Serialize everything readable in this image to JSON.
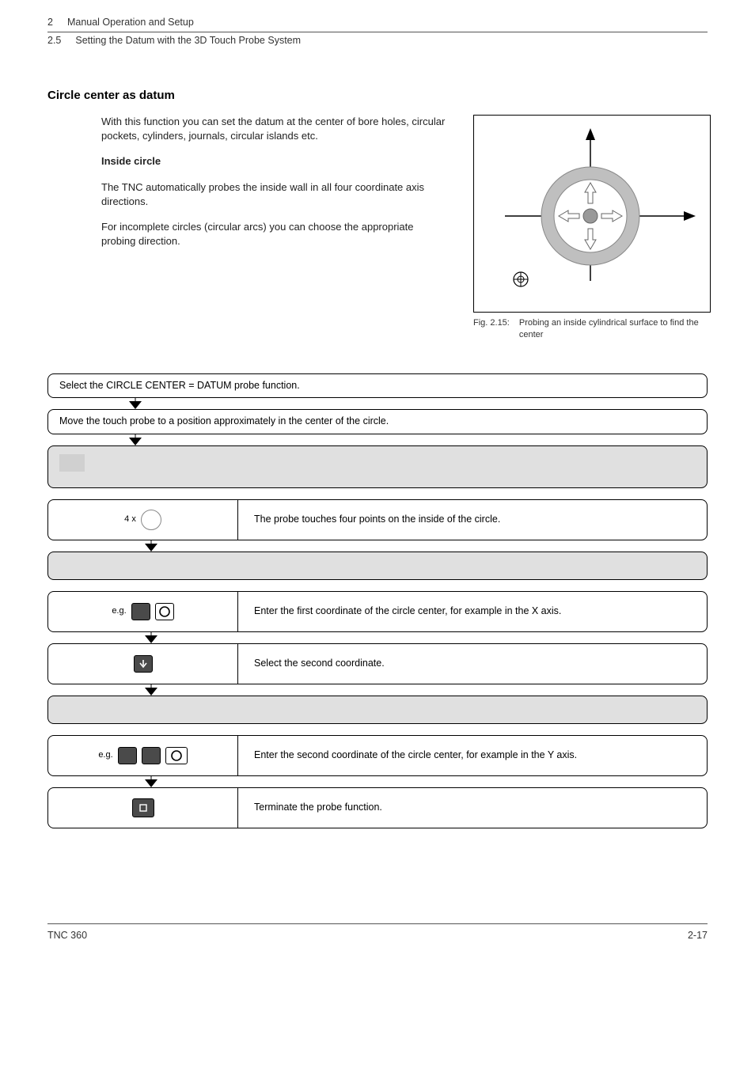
{
  "header": {
    "chapter_num": "2",
    "chapter_title": "Manual Operation and Setup",
    "section_num": "2.5",
    "section_title": "Setting the Datum with the 3D Touch Probe System"
  },
  "title": "Circle center as datum",
  "intro": "With this function you can set the datum at the center of bore holes, circular pockets, cylinders, journals, circular islands etc.",
  "sub_heading": "Inside circle",
  "para1": "The TNC automatically probes the inside wall in all four coordinate axis directions.",
  "para2": "For incomplete circles (circular arcs) you can choose the appropriate probing direction.",
  "figure": {
    "label": "Fig. 2.15:",
    "caption": "Probing an inside cylindrical surface to find the center"
  },
  "steps": {
    "s1": "Select the CIRCLE CENTER = DATUM probe function.",
    "s2": "Move the touch probe to a position approximately in the center of the circle.",
    "s3_left": "4 x",
    "s3_right": "The probe touches four points on the inside of the circle.",
    "s4_left": "e.g.",
    "s4_right": "Enter the first coordinate of the circle center, for example in the X axis.",
    "s5_right": "Select the second coordinate.",
    "s6_left": "e.g.",
    "s6_right": "Enter the second coordinate of the circle center, for example in the Y axis.",
    "s7_right": "Terminate the probe function."
  },
  "footer": {
    "left": "TNC 360",
    "right": "2-17"
  }
}
